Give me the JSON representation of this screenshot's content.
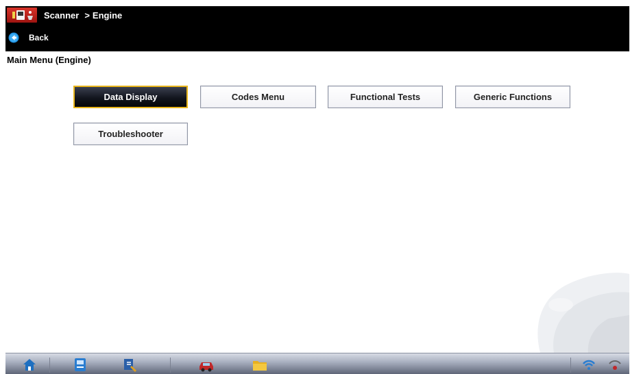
{
  "titlebar": {
    "app_name": "Scanner",
    "separator": ">",
    "crumb": "Engine"
  },
  "backbar": {
    "back_label": "Back"
  },
  "page": {
    "title": "Main Menu (Engine)"
  },
  "menu_buttons": [
    {
      "label": "Data Display",
      "selected": true
    },
    {
      "label": "Codes Menu",
      "selected": false
    },
    {
      "label": "Functional Tests",
      "selected": false
    },
    {
      "label": "Generic Functions",
      "selected": false
    },
    {
      "label": "Troubleshooter",
      "selected": false
    }
  ],
  "taskbar": {
    "icons": [
      "home-icon",
      "scanner-icon",
      "tools-icon",
      "vehicle-icon",
      "folder-icon",
      "wireless-icon",
      "connection-icon"
    ]
  },
  "colors": {
    "selected_border": "#e8b51a",
    "titlebar_bg": "#000000",
    "app_icon_red": "#d8342a"
  }
}
